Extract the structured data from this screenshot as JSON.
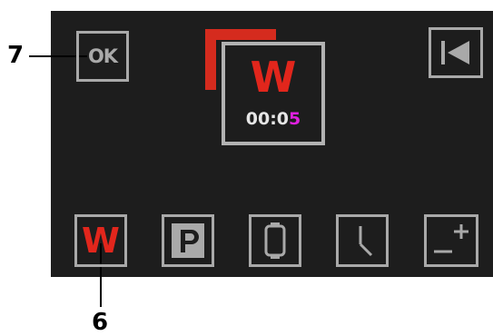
{
  "callouts": {
    "top_left": "7",
    "bottom": "6"
  },
  "toolbar": {
    "ok_label": "OK",
    "back_icon": "skip-back-icon"
  },
  "program": {
    "letter": "W",
    "time_prefix": "00:0",
    "time_highlight": "5"
  },
  "bottom_bar": {
    "w_label": "W",
    "p_label": "P",
    "timer_icon": "watch-icon",
    "clock_icon": "clock-icon",
    "plusminus_icon": "plus-minus-icon"
  },
  "colors": {
    "screen_bg": "#1d1d1d",
    "accent_red": "#e2261c",
    "frame_gray": "#a9a9a9",
    "time_highlight": "#e020e0"
  }
}
